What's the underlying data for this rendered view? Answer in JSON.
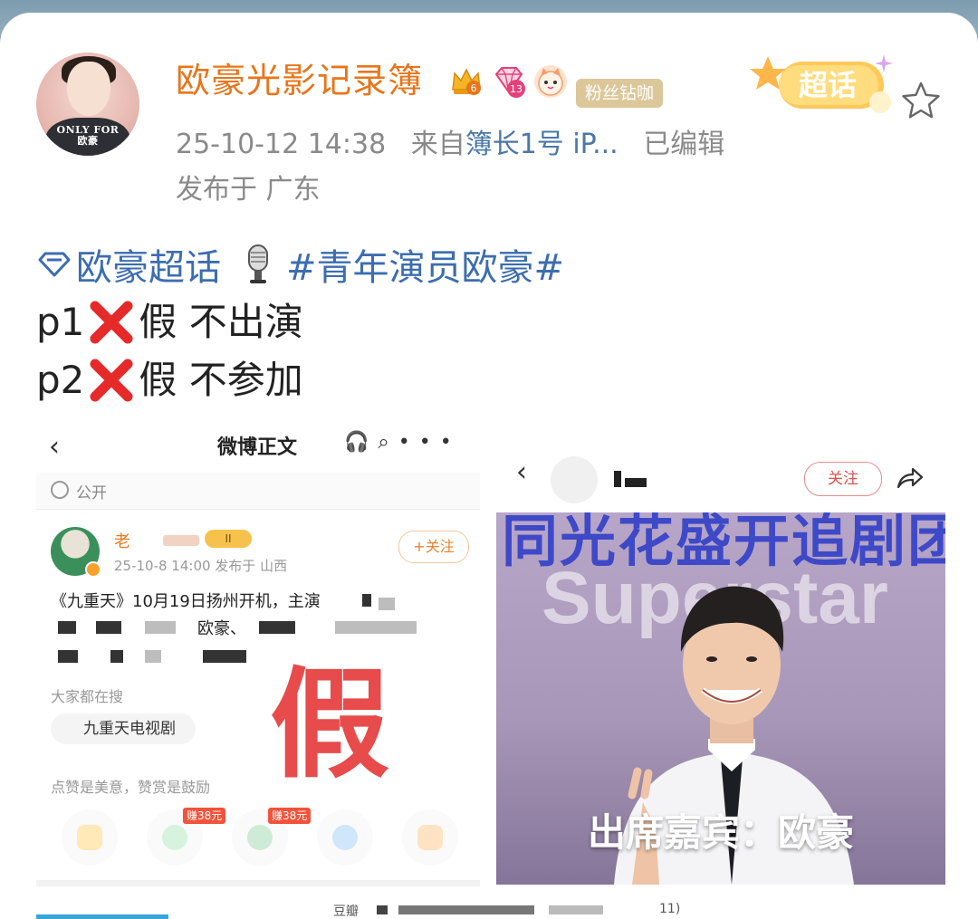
{
  "post": {
    "username": "欧豪光影记录簿",
    "avatar_text": "ONLY FOR\n欧豪",
    "crown_level": "6",
    "gem_level": "13",
    "fan_badge": "粉丝钻咖",
    "super_topic_label": "超话",
    "timestamp": "25-10-12 14:38",
    "source_prefix": "来自",
    "source": "簿长1号 iP...",
    "edited": "已编辑",
    "location": "发布于 广东",
    "topic": "欧豪超话",
    "hashtag": "#青年演员欧豪#",
    "lines": [
      {
        "prefix": "p1",
        "text": "假 不出演"
      },
      {
        "prefix": "p2",
        "text": "假 不参加"
      }
    ]
  },
  "shot_left": {
    "nav_title": "微博正文",
    "visibility": "公开",
    "username": "老",
    "badge": "II",
    "follow": "+关注",
    "time_location": "25-10-8 14:00  发布于 山西",
    "post_text": "《九重天》10月19日扬州开机，主演",
    "name_visible": "欧豪、",
    "search_label": "大家都在搜",
    "search_query": "九重天电视剧",
    "fake_stamp": "假",
    "like_hint": "点赞是美意，赞赏是鼓励",
    "reward_tags": [
      "赚38元",
      "赚38元"
    ]
  },
  "shot_right": {
    "follow": "关注",
    "poster_title": "同光花盛开追剧团",
    "poster_brand": "Superstar",
    "guest_line": "出席嘉宾：欧豪"
  },
  "caption": {
    "source": "豆瓣",
    "suffix": "11)"
  },
  "colors": {
    "username": "#e8751a",
    "topic": "#3c6db0",
    "fake": "#e74b4b",
    "poster_title": "#3e49c8"
  }
}
